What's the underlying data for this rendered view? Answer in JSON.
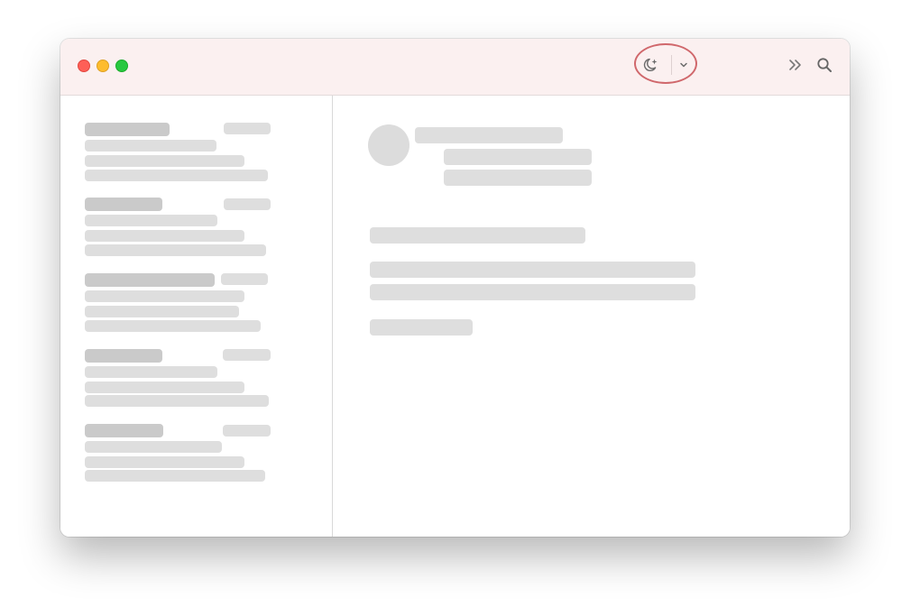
{
  "window": {
    "traffic_lights": [
      {
        "name": "close",
        "color": "#fe5f57"
      },
      {
        "name": "minimize",
        "color": "#febc2e"
      },
      {
        "name": "zoom",
        "color": "#28c840"
      }
    ]
  },
  "toolbar": {
    "theme_button_icon": "moon-sparkle-icon",
    "theme_menu_icon": "chevron-down-icon",
    "overflow_icon": "double-chevron-right-icon",
    "search_icon": "search-icon",
    "highlight_color": "#d0686c",
    "titlebar_color": "#fbf0f0"
  },
  "sidebar": {
    "items": [
      {
        "title": "",
        "date": "",
        "preview": ""
      },
      {
        "title": "",
        "date": "",
        "preview": ""
      },
      {
        "title": "",
        "date": "",
        "preview": ""
      },
      {
        "title": "",
        "date": "",
        "preview": ""
      },
      {
        "title": "",
        "date": "",
        "preview": ""
      }
    ]
  },
  "content": {
    "sender": "",
    "subject": "",
    "body": ""
  }
}
